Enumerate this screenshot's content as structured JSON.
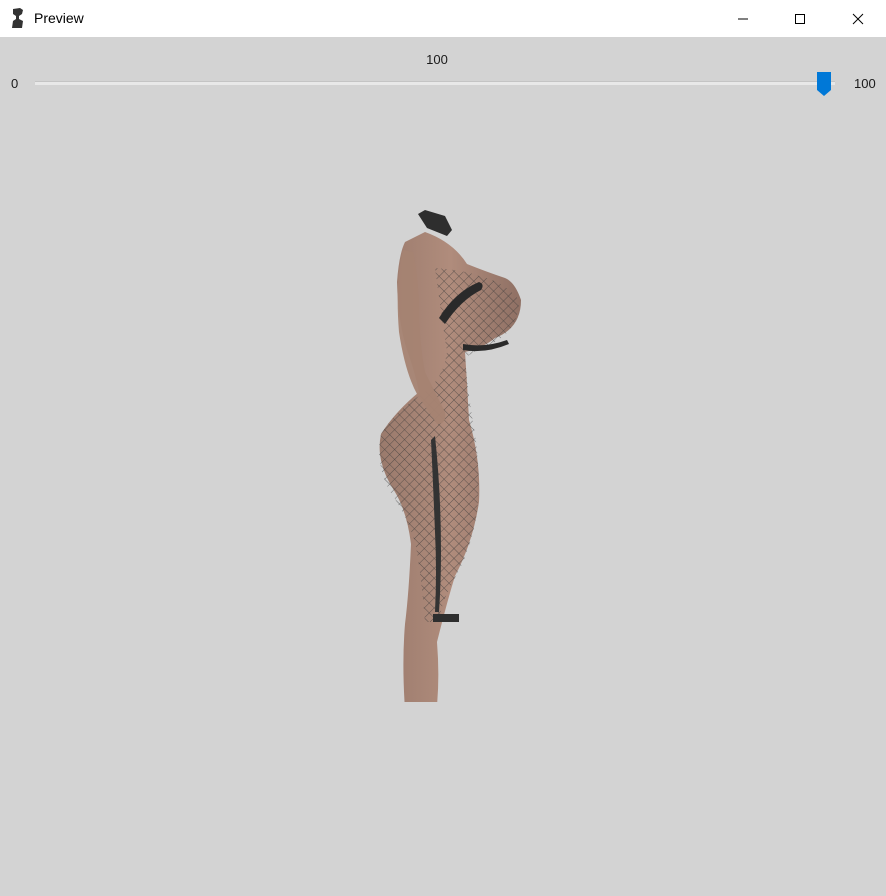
{
  "window": {
    "title": "Preview",
    "app_icon": "bust-icon",
    "controls": {
      "minimize": "minimize-icon",
      "maximize": "maximize-icon",
      "close": "close-icon"
    }
  },
  "slider": {
    "current_value": "100",
    "min_label": "0",
    "max_label": "100",
    "value_fraction": 1.0,
    "accent_color": "#0078d7"
  },
  "viewport": {
    "background_color": "#d3d3d3",
    "subject": "3d-body-model"
  }
}
